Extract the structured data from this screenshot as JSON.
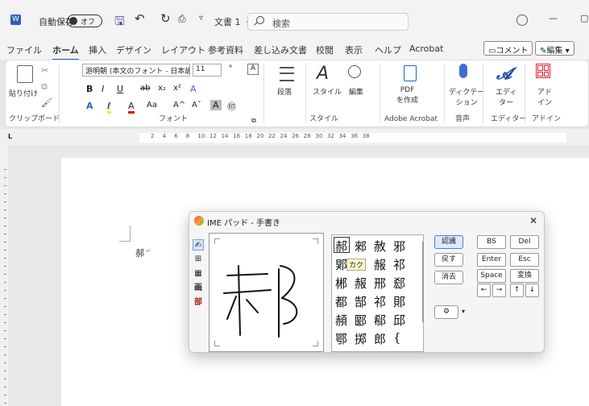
{
  "titlebar": {
    "logo": "W",
    "autosave": "自動保存",
    "toggle": "オフ",
    "doc_title": "文書 1 ・・・",
    "search_placeholder": "検索",
    "min": "—",
    "max": "▢"
  },
  "menu": {
    "tabs": [
      "ファイル",
      "ホーム",
      "挿入",
      "デザイン",
      "レイアウト",
      "参考資料",
      "差し込み文書",
      "校閲",
      "表示",
      "ヘルプ",
      "Acrobat"
    ],
    "comment": "コメント",
    "edit": "編集"
  },
  "ribbon": {
    "clipboard": {
      "paste": "貼り付け",
      "label": "クリップボード"
    },
    "font": {
      "name": "游明朝 (本文のフォント - 日本語)",
      "size": "11",
      "label": "フォント",
      "bold": "B",
      "italic": "I",
      "underline": "U",
      "strike": "ab",
      "sub": "x₂",
      "sup": "x²",
      "clear": "A",
      "color": "A",
      "highlight": "ℓ",
      "fontcolor": "A",
      "aa": "Aa",
      "grow": "A^",
      "shrink": "Aˇ",
      "abox": "A",
      "circle": "㊞"
    },
    "paragraph": {
      "label": "段落"
    },
    "styles": {
      "label": "スタイル",
      "group": "スタイル"
    },
    "editing": {
      "label": "編集"
    },
    "pdf": {
      "label": "PDF\nを作成",
      "group": "Adobe Acrobat"
    },
    "dictate": {
      "label": "ディクテー\nション",
      "group": "音声"
    },
    "editor": {
      "label": "エディ\nター",
      "group": "エディター"
    },
    "addin": {
      "label": "アド\nイン",
      "group": "アドイン"
    }
  },
  "ruler": {
    "ticks": [
      "2",
      "4",
      "6",
      "8",
      "10",
      "12",
      "14",
      "16",
      "18",
      "20",
      "22",
      "24",
      "26",
      "28",
      "30",
      "32",
      "34",
      "36",
      "38"
    ]
  },
  "document": {
    "text": "郝"
  },
  "ime": {
    "title": "IME パッド - 手書き",
    "close": "✕",
    "side_icons": [
      "✍",
      "⊞",
      "▦",
      "画",
      "部"
    ],
    "candidates": [
      [
        "郝",
        "郲",
        "赦",
        "邪"
      ],
      [
        "郹",
        "郄",
        "赧",
        "祁"
      ],
      [
        "郴",
        "赧",
        "邢",
        "郄"
      ],
      [
        "都",
        "郜",
        "祁",
        "郥"
      ],
      [
        "頳",
        "郾",
        "郗",
        "邱"
      ],
      [
        "鄂",
        "掷",
        "郎",
        "{"
      ]
    ],
    "tooltip": "カク",
    "buttons": {
      "recognize": "認識",
      "back": "戻す",
      "clear": "消去",
      "bs": "BS",
      "del": "Del",
      "enter": "Enter",
      "esc": "Esc",
      "space": "Space",
      "convert": "変換",
      "left": "←",
      "right": "→",
      "up": "↑",
      "down": "↓"
    }
  }
}
